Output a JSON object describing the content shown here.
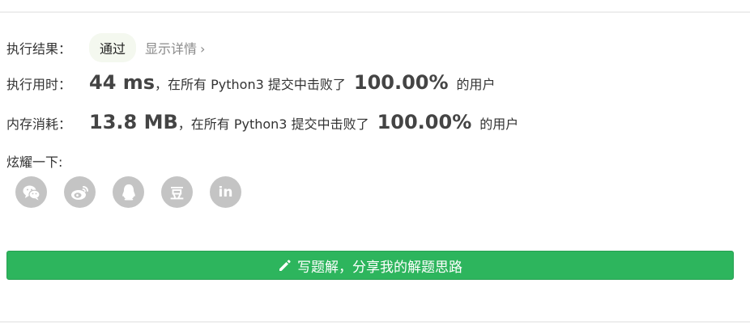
{
  "result": {
    "label": "执行结果：",
    "status": "通过",
    "details_link": "显示详情",
    "chevron": "›"
  },
  "runtime": {
    "label": "执行用时：",
    "value": "44 ms",
    "text_before": "，在所有 Python3 提交中击败了",
    "percent": "100.00%",
    "text_after": "的用户"
  },
  "memory": {
    "label": "内存消耗：",
    "value": "13.8 MB",
    "text_before": "，在所有 Python3 提交中击败了",
    "percent": "100.00%",
    "text_after": "的用户"
  },
  "share": {
    "label": "炫耀一下:",
    "icons": [
      {
        "name": "wechat-icon"
      },
      {
        "name": "weibo-icon"
      },
      {
        "name": "qq-icon"
      },
      {
        "name": "douban-icon",
        "glyph": "豆"
      },
      {
        "name": "linkedin-icon",
        "glyph": "in"
      }
    ]
  },
  "solution_button": {
    "icon": "pencil-icon",
    "label": "写题解，分享我的解题思路"
  },
  "colors": {
    "accent_green": "#2db55d",
    "icon_gray": "#c4c4c4",
    "badge_bg": "#f4f8ef"
  }
}
